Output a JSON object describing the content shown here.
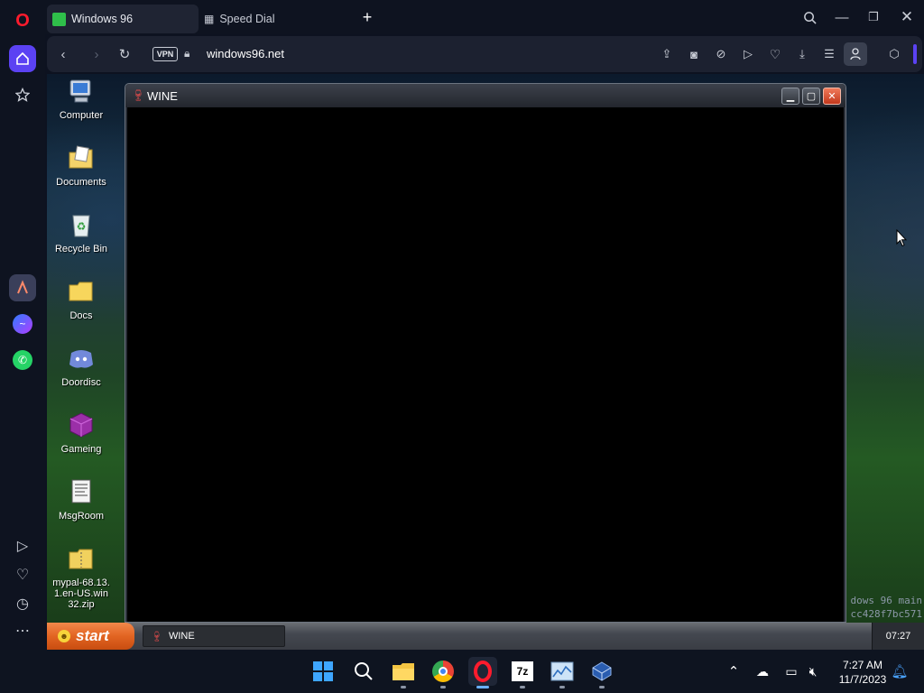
{
  "browser": {
    "tabs": [
      {
        "label": "Windows 96",
        "active": true
      },
      {
        "label": "Speed Dial",
        "active": false
      }
    ],
    "vpn_label": "VPN",
    "url": "windows96.net"
  },
  "desktop": {
    "icons": [
      {
        "label": "Computer"
      },
      {
        "label": "Documents"
      },
      {
        "label": "Recycle Bin"
      },
      {
        "label": "Docs"
      },
      {
        "label": "Doordisc"
      },
      {
        "label": "Gameing"
      },
      {
        "label": "MsgRoom"
      },
      {
        "label": "mypal-68.13.1.en-US.win32.zip"
      }
    ],
    "version_text": [
      "dows 96 main",
      "cc428f7bc571"
    ]
  },
  "wine_window": {
    "title": "WINE"
  },
  "w96_taskbar": {
    "start_label": "start",
    "task_label": "WINE",
    "clock": "07:27"
  },
  "os_taskbar": {
    "time": "7:27 AM",
    "date": "11/7/2023"
  },
  "colors": {
    "opera_red": "#ff1b2d",
    "active_sidebar": "#5b42f3",
    "start_orange": "#e26422"
  }
}
